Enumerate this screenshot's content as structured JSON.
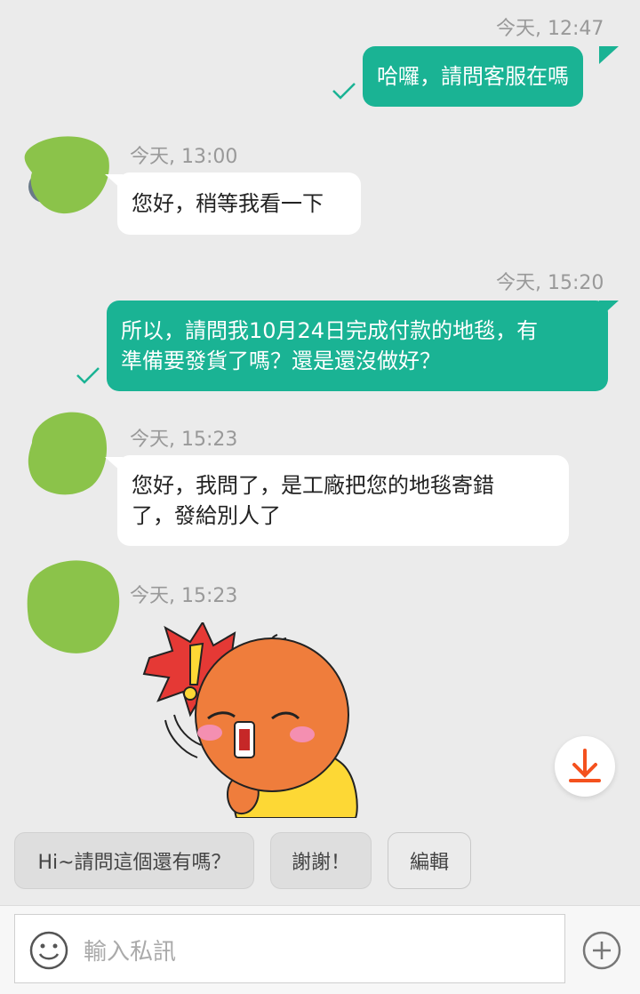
{
  "messages": [
    {
      "timestamp": "今天, 12:47",
      "direction": "out",
      "text": "哈囉，請問客服在嗎"
    },
    {
      "timestamp": "今天, 13:00",
      "direction": "in",
      "text": "您好，稍等我看一下"
    },
    {
      "timestamp": "今天, 15:20",
      "direction": "out",
      "line1": "所以，請問我10月24日完成付款的地毯，有",
      "line2": "準備要發貨了嗎？還是還沒做好？"
    },
    {
      "timestamp": "今天, 15:23",
      "direction": "in",
      "line1": "您好，我問了，是工廠把您的地毯寄錯",
      "line2": "了，發給別人了"
    },
    {
      "timestamp": "今天, 15:23",
      "direction": "in",
      "sticker": "shocked-orange-character-sticker"
    }
  ],
  "quick_replies": [
    "Hi~請問這個還有嗎？",
    "謝謝！",
    "編輯"
  ],
  "input": {
    "placeholder": "輸入私訊"
  },
  "colors": {
    "accent": "#1ab394",
    "avatar": "#8bc34a",
    "download": "#f4511e",
    "background": "#ebebeb"
  },
  "icons": [
    "check-icon",
    "download-icon",
    "emoji-icon",
    "add-icon"
  ]
}
